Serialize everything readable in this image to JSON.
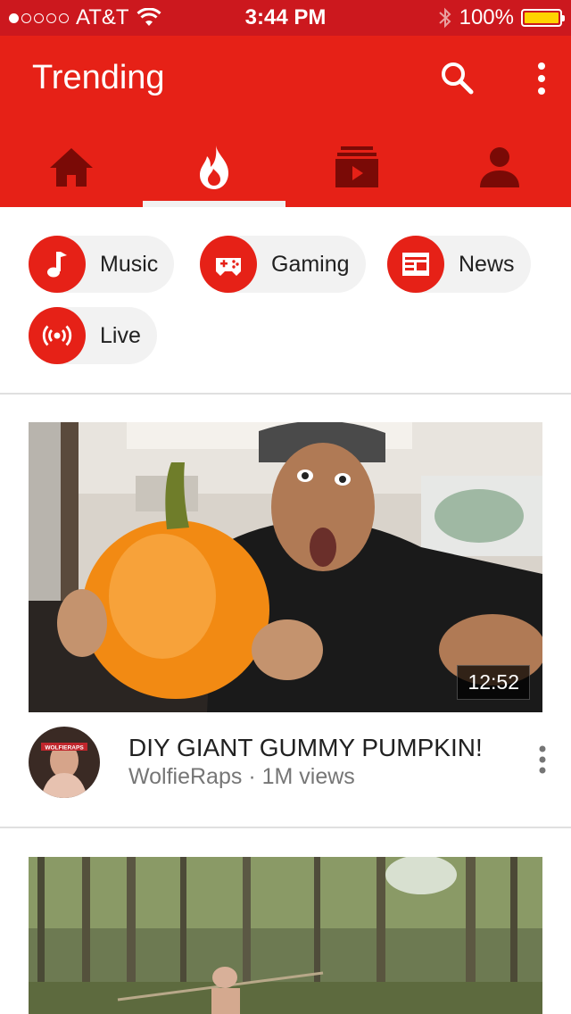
{
  "status_bar": {
    "carrier": "AT&T",
    "time": "3:44 PM",
    "battery": "100%",
    "signal_bars": 1,
    "battery_level": 1.0
  },
  "header": {
    "title": "Trending",
    "search_icon": "search-icon",
    "more_icon": "more-vert-icon"
  },
  "tabs": [
    {
      "name": "home",
      "icon": "home-icon"
    },
    {
      "name": "trending",
      "icon": "flame-icon",
      "active": true
    },
    {
      "name": "subscriptions",
      "icon": "subscriptions-icon"
    },
    {
      "name": "account",
      "icon": "account-icon"
    }
  ],
  "categories": [
    {
      "label": "Music",
      "icon": "music-note-icon"
    },
    {
      "label": "Gaming",
      "icon": "gamepad-icon"
    },
    {
      "label": "News",
      "icon": "newspaper-icon"
    },
    {
      "label": "Live",
      "icon": "live-broadcast-icon"
    }
  ],
  "videos": [
    {
      "title": "DIY GIANT GUMMY PUMPKIN!",
      "channel": "WolfieRaps",
      "separator": "·",
      "views": "1M views",
      "duration": "12:52",
      "avatar_text": "WOLFIERAPS"
    }
  ],
  "colors": {
    "status_bar": "#cc181e",
    "app_bar": "#e62117",
    "tab_icon_inactive": "#7a0a06",
    "tab_icon_active": "#ffffff",
    "chip_bg": "#f2f2f2"
  }
}
